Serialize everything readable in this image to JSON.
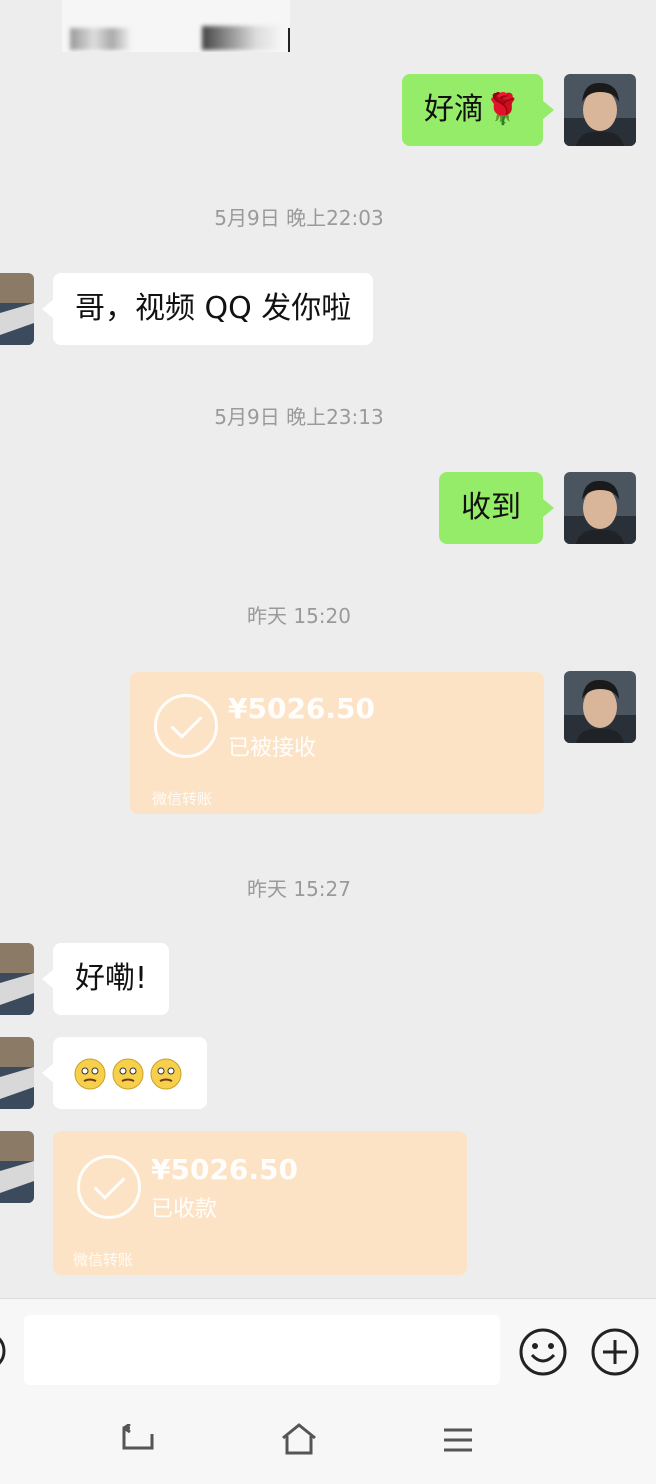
{
  "messages": {
    "m1_text": "好滴🌹",
    "ts1": "5月9日 晚上22:03",
    "m2_text": "哥，视频 QQ 发你啦",
    "ts2": "5月9日 晚上23:13",
    "m3_text": "收到",
    "ts3": "昨天 15:20",
    "transfer1": {
      "amount": "¥5026.50",
      "status": "已被接收",
      "label": "微信转账"
    },
    "ts4": "昨天 15:27",
    "m4_text": "好嘞!",
    "transfer2": {
      "amount": "¥5026.50",
      "status": "已收款",
      "label": "微信转账"
    }
  },
  "input_bar": {
    "icons": [
      "voice-icon",
      "emoji-icon",
      "plus-icon"
    ]
  },
  "nav_bar": {
    "icons": [
      "back-icon",
      "home-icon",
      "menu-icon"
    ]
  },
  "colors": {
    "background": "#ededed",
    "sent_bubble": "#95ec69",
    "received_bubble": "#ffffff",
    "transfer_card": "#fde3c6"
  }
}
